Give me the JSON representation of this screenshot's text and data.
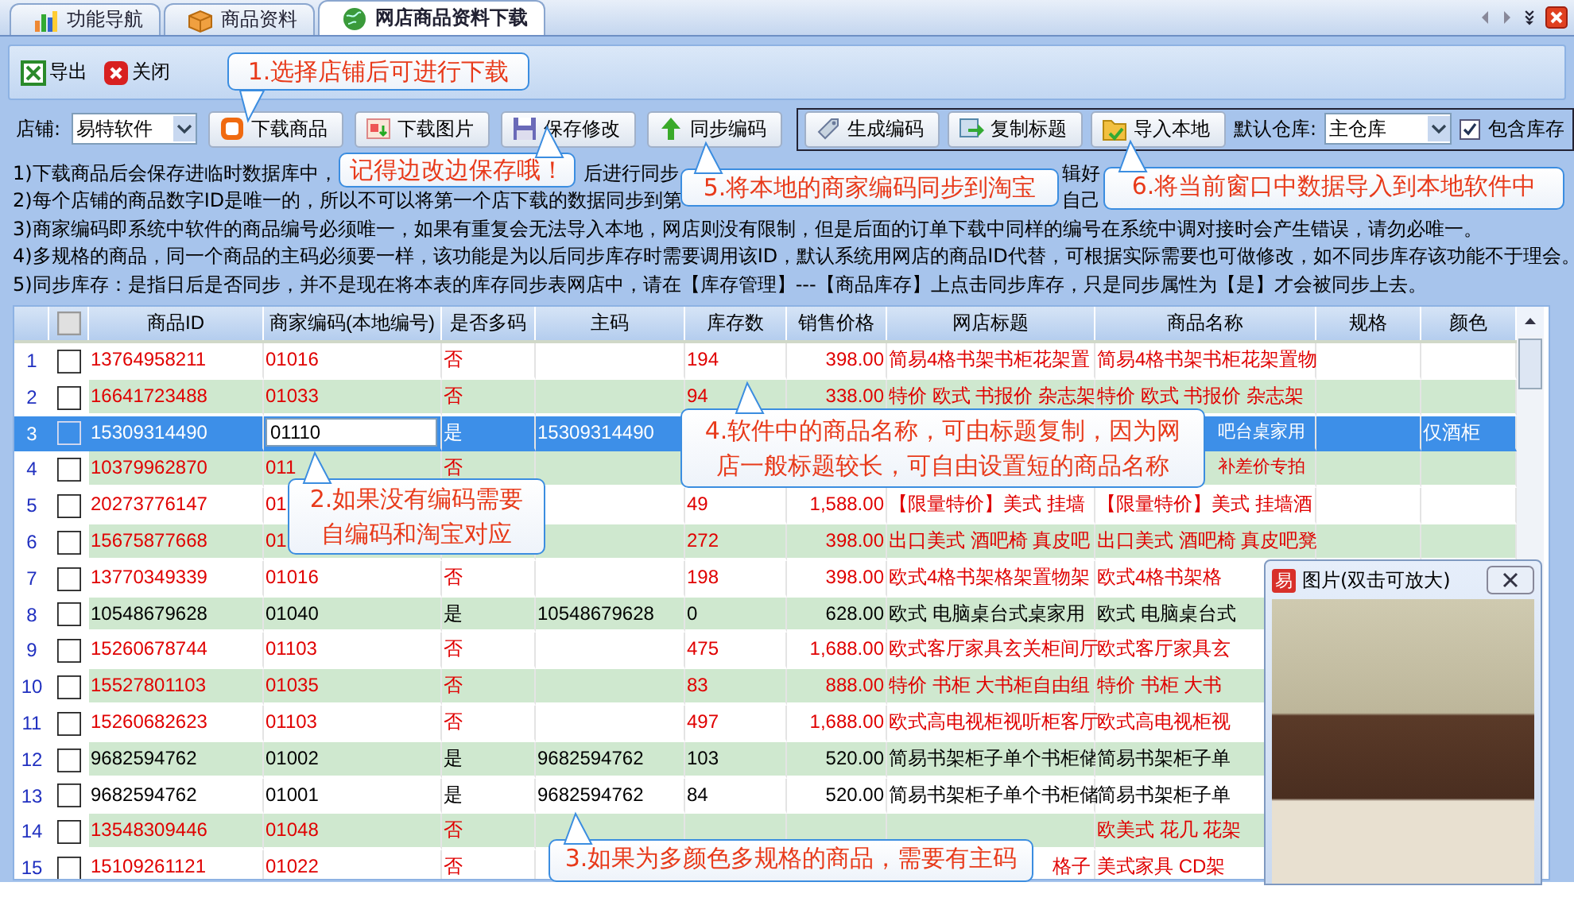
{
  "tabs": [
    {
      "label": "功能导航",
      "kind": "chart",
      "selected": false
    },
    {
      "label": "商品资料",
      "kind": "box",
      "selected": false
    },
    {
      "label": "网店商品资料下载",
      "kind": "globe",
      "selected": true
    }
  ],
  "toolbar": [
    {
      "label": "导出",
      "kind": "excel"
    },
    {
      "label": "关闭",
      "kind": "close"
    }
  ],
  "shop": {
    "label": "店铺:",
    "value": "易特软件"
  },
  "actions": [
    {
      "label": "下载商品",
      "kind": "taobao"
    },
    {
      "label": "下载图片",
      "kind": "image"
    },
    {
      "label": "保存修改",
      "kind": "save"
    },
    {
      "label": "同步编码",
      "kind": "upload"
    }
  ],
  "group_actions": [
    {
      "label": "生成编码",
      "kind": "tag"
    },
    {
      "label": "复制标题",
      "kind": "copy"
    },
    {
      "label": "导入本地",
      "kind": "import"
    }
  ],
  "warehouse": {
    "label": "默认仓库:",
    "value": "主仓库"
  },
  "include_stock": {
    "label": "包含库存",
    "checked": true
  },
  "notes": [
    [
      "1)下载商品后会保存进临时数据库中，",
      "后进行同步",
      "辑好"
    ],
    [
      "2)每个店铺的商品数字ID是唯一的，所以不可以将第一个店下载的数据同步到第",
      "自己"
    ],
    [
      "3)商家编码即系统中软件的商品编号必须唯一，如果有重复会无法导入本地，网店则没有限制，但是后面的订单下载中同样的编号在系统中调对接时会产生错误，请勿必唯一。"
    ],
    [
      "4)多规格的商品，同一个商品的主码必须要一样，该功能是为以后同步库存时需要调用该ID，默认系统用网店的商品ID代替，可根据实际需要也可做修改，如不同步库存该功能不于理会。"
    ],
    [
      "5)同步库存：是指日后是否同步，并不是现在将本表的库存同步表网店中，请在【库存管理】---【商品库存】上点击同步库存，只是同步属性为【是】才会被同步上去。"
    ]
  ],
  "table": {
    "header_checked": false,
    "columns": [
      "商品ID",
      "商家编码(本地编号)",
      "是否多码",
      "主码",
      "库存数",
      "销售价格",
      "网店标题",
      "商品名称",
      "规格",
      "颜色"
    ],
    "rows": [
      {
        "no": "1",
        "checked": false,
        "selected": false,
        "editing": false,
        "color": "#e00000",
        "cells": [
          "13764958211",
          "01016",
          "否",
          null,
          "194",
          "398.00",
          "简易4格书架书柜花架置",
          "简易4格书架书柜花架置物",
          null,
          null
        ]
      },
      {
        "no": "2",
        "checked": false,
        "selected": false,
        "editing": false,
        "color": "#e00000",
        "cells": [
          "16641723488",
          "01033",
          "否",
          null,
          "94",
          "338.00",
          "特价 欧式 书报价 杂志架",
          "特价 欧式 书报价 杂志架",
          null,
          null
        ]
      },
      {
        "no": "3",
        "checked": false,
        "selected": true,
        "editing": true,
        "cells": [
          "15309314490",
          "01110",
          "是",
          "15309314490",
          null,
          null,
          null,
          "吧台桌家用",
          null,
          "仅酒柜"
        ]
      },
      {
        "no": "4",
        "checked": false,
        "selected": false,
        "editing": false,
        "color": "#e00000",
        "cells": [
          "10379962870",
          "011",
          "否",
          null,
          null,
          null,
          null,
          "补差价专拍",
          null,
          null
        ]
      },
      {
        "no": "5",
        "checked": false,
        "selected": false,
        "editing": false,
        "color": "#e00000",
        "cells": [
          "20273776147",
          "01",
          null,
          null,
          "49",
          "1,588.00",
          "【限量特价】美式 挂墙",
          "【限量特价】美式 挂墙酒",
          null,
          null
        ]
      },
      {
        "no": "6",
        "checked": false,
        "selected": false,
        "editing": false,
        "color": "#e00000",
        "cells": [
          "15675877668",
          "01",
          null,
          null,
          "272",
          "398.00",
          "出口美式 酒吧椅 真皮吧",
          "出口美式 酒吧椅 真皮吧凳",
          null,
          null
        ]
      },
      {
        "no": "7",
        "checked": false,
        "selected": false,
        "editing": false,
        "color": "#e00000",
        "cells": [
          "13770349339",
          "01016",
          "否",
          null,
          "198",
          "398.00",
          "欧式4格书架格架置物架",
          "欧式4格书架格",
          null,
          null
        ]
      },
      {
        "no": "8",
        "checked": false,
        "selected": false,
        "editing": false,
        "color": "#000000",
        "cells": [
          "10548679628",
          "01040",
          "是",
          "10548679628",
          "0",
          "628.00",
          "欧式 电脑桌台式桌家用",
          "欧式 电脑桌台式",
          null,
          null
        ]
      },
      {
        "no": "9",
        "checked": false,
        "selected": false,
        "editing": false,
        "color": "#e00000",
        "cells": [
          "15260678744",
          "01103",
          "否",
          null,
          "475",
          "1,688.00",
          "欧式客厅家具玄关柜间厅",
          "欧式客厅家具玄",
          null,
          null
        ]
      },
      {
        "no": "10",
        "checked": false,
        "selected": false,
        "editing": false,
        "color": "#e00000",
        "cells": [
          "15527801103",
          "01035",
          "否",
          null,
          "83",
          "888.00",
          "特价 书柜 大书柜自由组",
          "特价 书柜 大书",
          null,
          null
        ]
      },
      {
        "no": "11",
        "checked": false,
        "selected": false,
        "editing": false,
        "color": "#e00000",
        "cells": [
          "15260682623",
          "01103",
          "否",
          null,
          "497",
          "1,688.00",
          "欧式高电视柜视听柜客厅",
          "欧式高电视柜视",
          null,
          null
        ]
      },
      {
        "no": "12",
        "checked": false,
        "selected": false,
        "editing": false,
        "color": "#000000",
        "cells": [
          "9682594762",
          "01002",
          "是",
          "9682594762",
          "103",
          "520.00",
          "简易书架柜子单个书柜储",
          "简易书架柜子单",
          null,
          null
        ]
      },
      {
        "no": "13",
        "checked": false,
        "selected": false,
        "editing": false,
        "color": "#000000",
        "cells": [
          "9682594762",
          "01001",
          "是",
          "9682594762",
          "84",
          "520.00",
          "简易书架柜子单个书柜储",
          "简易书架柜子单",
          null,
          null
        ]
      },
      {
        "no": "14",
        "checked": false,
        "selected": false,
        "editing": false,
        "color": "#e00000",
        "cells": [
          "13548309446",
          "01048",
          "否",
          null,
          null,
          null,
          null,
          "欧美式 花几 花架",
          null,
          null
        ]
      },
      {
        "no": "15",
        "checked": false,
        "selected": false,
        "editing": false,
        "color": "#e00000",
        "cells": [
          "15109261121",
          "01022",
          "否",
          null,
          null,
          null,
          "格子",
          "美式家具 CD架",
          null,
          null
        ]
      }
    ]
  },
  "callouts": [
    "1.选择店铺后可进行下载",
    "记得边改边保存哦！",
    "5.将本地的商家编码同步到淘宝",
    "6.将当前窗口中数据导入到本地软件中",
    "4.软件中的商品名称，可由标题复制，因为网店一般标题较长，可自由设置短的商品名称",
    "2.如果没有编码需要自编码和淘宝对应",
    "3.如果为多颜色多规格的商品，需要有主码"
  ],
  "image_popup": {
    "icon": "易",
    "title": "图片(双击可放大)"
  }
}
